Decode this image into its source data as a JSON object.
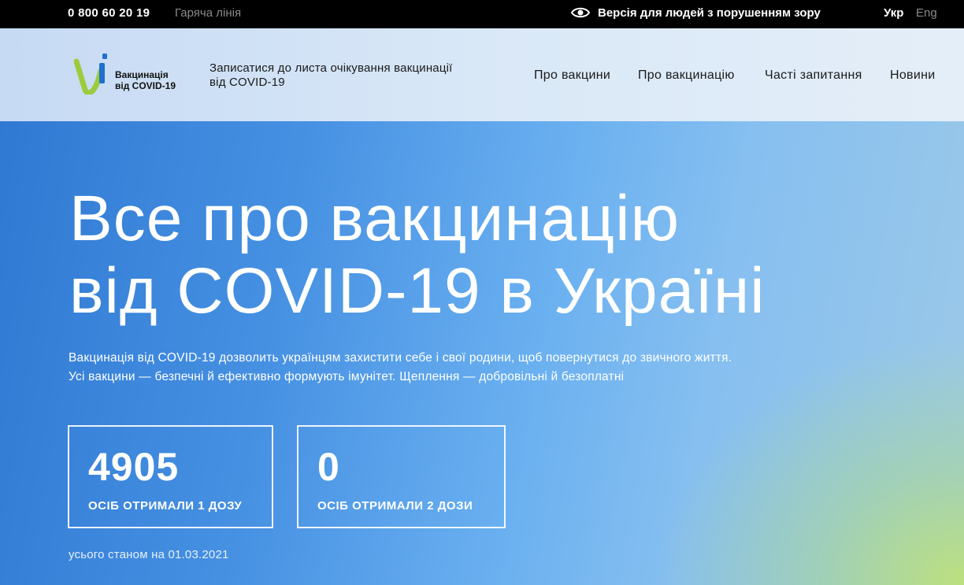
{
  "topbar": {
    "phone": "0 800 60 20 19",
    "hotline": "Гаряча лінія",
    "accessibility": "Версія для людей з порушенням зору",
    "accessibility_icon": "eye-icon",
    "lang_ukr": "Укр",
    "lang_eng": "Eng"
  },
  "header": {
    "logo_line1": "Вакцинація",
    "logo_line2": "від COVID-19",
    "waitlist_line1": "Записатися до листа очікування вакцинації",
    "waitlist_line2": "від COVID-19",
    "nav": [
      "Про вакцини",
      "Про вакцинацію",
      "Часті запитання",
      "Новини"
    ]
  },
  "hero": {
    "title_line1": "Все про вакцинацію",
    "title_line2": "від COVID-19 в Україні",
    "desc_line1": "Вакцинація від COVID-19 дозволить українцям захистити себе і свої родини, щоб повернутися до звичного життя.",
    "desc_line2": "Усі вакцини — безпечні й ефективно формують імунітет. Щеплення — добровільні й безоплатні",
    "stats": [
      {
        "value": "4905",
        "label": "ОСІБ ОТРИМАЛИ 1 ДОЗУ"
      },
      {
        "value": "0",
        "label": "ОСІБ ОТРИМАЛИ 2 ДОЗИ"
      }
    ],
    "as_of": "усього станом на 01.03.2021"
  },
  "colors": {
    "topbar_bg": "#000000",
    "logo_green": "#9ccc3c",
    "logo_blue": "#1f6fd1",
    "hero_blue": "#3b82dc",
    "hero_green": "#b9dc86"
  }
}
